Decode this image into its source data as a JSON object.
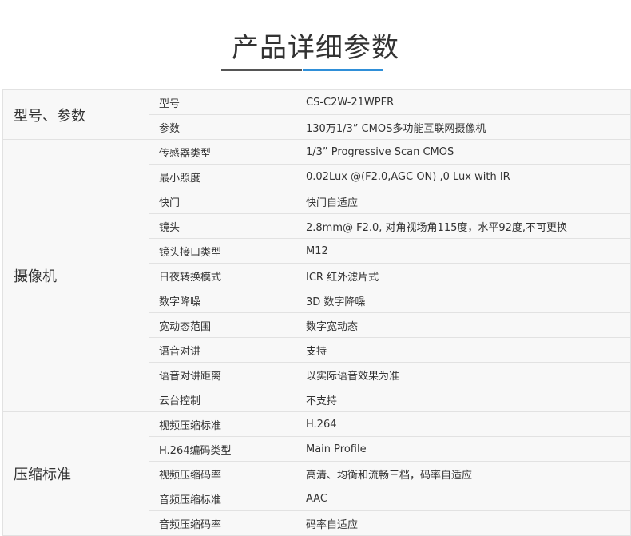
{
  "title": "产品详细参数",
  "groups": [
    {
      "name": "型号、参数",
      "rows": [
        {
          "label": "型号",
          "value": "CS-C2W-21WPFR"
        },
        {
          "label": "参数",
          "value": "130万1/3” CMOS多功能互联网摄像机"
        }
      ]
    },
    {
      "name": "摄像机",
      "rows": [
        {
          "label": "传感器类型",
          "value": "1/3” Progressive Scan CMOS"
        },
        {
          "label": "最小照度",
          "value": "0.02Lux @(F2.0,AGC ON) ,0 Lux with IR"
        },
        {
          "label": "快门",
          "value": "快门自适应"
        },
        {
          "label": "镜头",
          "value": "2.8mm@ F2.0, 对角视场角115度，水平92度,不可更换"
        },
        {
          "label": "镜头接口类型",
          "value": "M12"
        },
        {
          "label": "日夜转换模式",
          "value": "ICR 红外滤片式"
        },
        {
          "label": "数字降噪",
          "value": "3D 数字降噪"
        },
        {
          "label": "宽动态范围",
          "value": "数字宽动态"
        },
        {
          "label": "语音对讲",
          "value": "支持"
        },
        {
          "label": "语音对讲距离",
          "value": "以实际语音效果为准"
        },
        {
          "label": "云台控制",
          "value": "不支持"
        }
      ]
    },
    {
      "name": "压缩标准",
      "rows": [
        {
          "label": "视频压缩标准",
          "value": "H.264"
        },
        {
          "label": "H.264编码类型",
          "value": "Main Profile"
        },
        {
          "label": "视频压缩码率",
          "value": "高清、均衡和流畅三档，码率自适应"
        },
        {
          "label": "音频压缩标准",
          "value": "AAC"
        },
        {
          "label": "音频压缩码率",
          "value": "码率自适应"
        }
      ]
    }
  ]
}
